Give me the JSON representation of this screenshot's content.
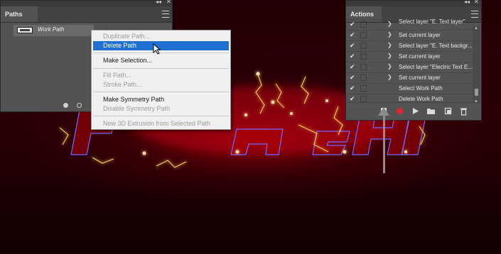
{
  "canvas": {
    "artwork_text": "FLASH",
    "accent_color": "#ff2a2a",
    "outline_color": "#7d6cff"
  },
  "paths_panel": {
    "tab_label": "Paths",
    "collapse_glyph": "◂◂",
    "close_glyph": "✕",
    "path_item_label": "Work Path",
    "menu_icon": "hamburger-icon"
  },
  "context_menu": {
    "items": [
      {
        "label": "Duplicate Path...",
        "state": "disabled"
      },
      {
        "label": "Delete Path",
        "state": "highlight"
      },
      {
        "label": "Make Selection...",
        "state": "enabled"
      },
      {
        "label": "Fill Path...",
        "state": "disabled"
      },
      {
        "label": "Stroke Path...",
        "state": "disabled"
      },
      {
        "label": "Make Symmetry Path",
        "state": "enabled"
      },
      {
        "label": "Disable Symmetry Path",
        "state": "disabled"
      },
      {
        "label": "New 3D Extrusion from Selected Path",
        "state": "disabled"
      }
    ],
    "highlight_color": "#1e70d3"
  },
  "actions_panel": {
    "tab_label": "Actions",
    "collapse_glyph": "◂◂",
    "close_glyph": "✕",
    "rows": [
      {
        "label": "Select layer \"E. Text layer\"",
        "checked": true,
        "expandable": true
      },
      {
        "label": "Set current layer",
        "checked": true,
        "expandable": true
      },
      {
        "label": "Select layer \"E. Text backgr...",
        "checked": true,
        "expandable": true
      },
      {
        "label": "Set current layer",
        "checked": true,
        "expandable": true
      },
      {
        "label": "Select layer \"Electric Text E...",
        "checked": true,
        "expandable": true
      },
      {
        "label": "Set current layer",
        "checked": true,
        "expandable": true
      },
      {
        "label": "Select Work Path",
        "checked": true,
        "expandable": false
      },
      {
        "label": "Delete Work Path",
        "checked": true,
        "expandable": false
      }
    ],
    "footer_buttons": [
      "stop-icon",
      "record-icon",
      "play-icon",
      "folder-icon",
      "new-action-icon",
      "trash-icon"
    ],
    "record_color": "#e0262f"
  }
}
